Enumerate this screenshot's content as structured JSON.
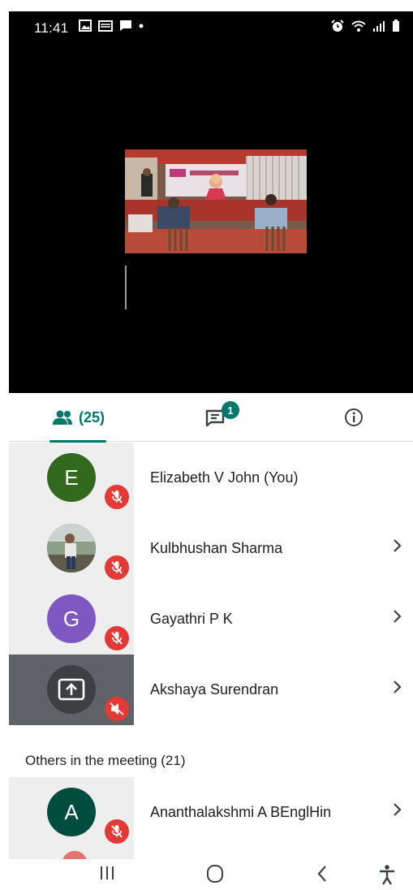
{
  "status_bar": {
    "time": "11:41",
    "left_icons": [
      "image-icon",
      "cast-icon",
      "message-icon",
      "dot-icon"
    ],
    "right_icons": [
      "alarm-icon",
      "wifi-icon",
      "signal-icon",
      "battery-icon"
    ]
  },
  "tabs": {
    "people_count": "(25)",
    "chat_badge": "1"
  },
  "participants": [
    {
      "initial": "E",
      "avatar_color": "#33691e",
      "name": "Elizabeth V John (You)",
      "muted": true,
      "has_chevron": false,
      "presenting": false
    },
    {
      "initial": "",
      "avatar_color": "#6d7b72",
      "name": "Kulbhushan Sharma",
      "muted": true,
      "has_chevron": true,
      "presenting": false,
      "photo": true
    },
    {
      "initial": "G",
      "avatar_color": "#7e57c2",
      "name": "Gayathri P K",
      "muted": true,
      "has_chevron": true,
      "presenting": false
    },
    {
      "initial": "",
      "avatar_color": "#3c4043",
      "name": "Akshaya Surendran",
      "muted": true,
      "has_chevron": true,
      "presenting": true
    }
  ],
  "others_header": "Others in the meeting (21)",
  "others": [
    {
      "initial": "A",
      "avatar_color": "#004d40",
      "name": "Ananthalakshmi A BEnglHin",
      "muted": true,
      "has_chevron": true
    }
  ],
  "colors": {
    "accent": "#00796b",
    "mute_red": "#e53935"
  }
}
